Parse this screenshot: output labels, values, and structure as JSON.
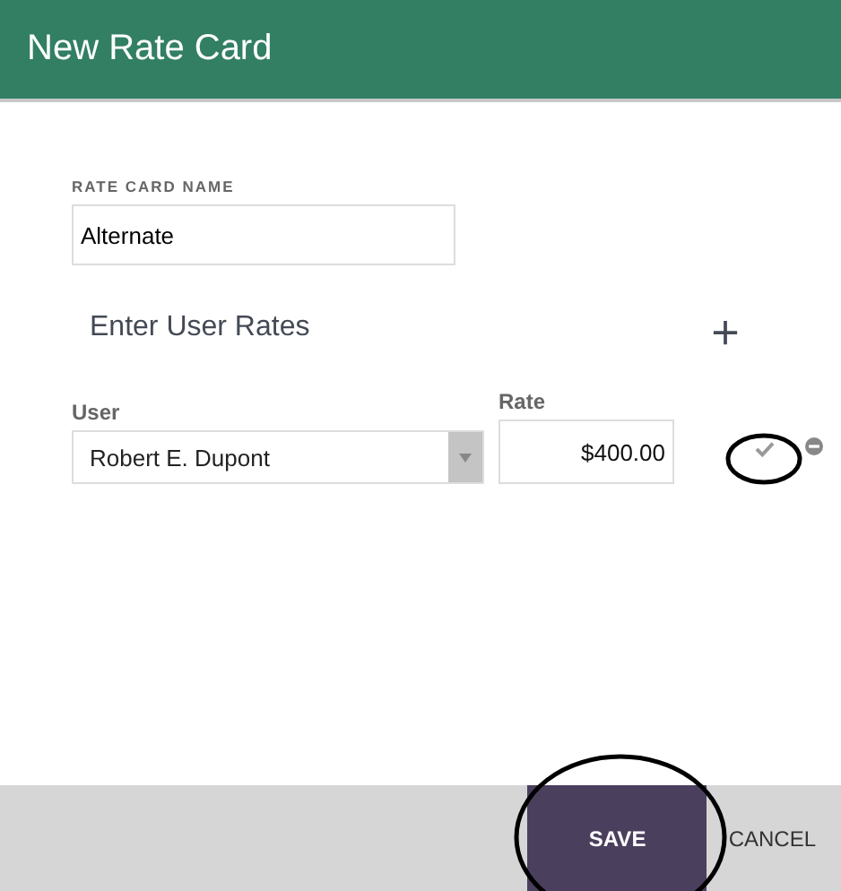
{
  "window": {
    "title": "New Rate Card"
  },
  "rate_card_name": {
    "label": "RATE CARD NAME",
    "value": "Alternate"
  },
  "user_rates": {
    "heading": "Enter User Rates",
    "rows": [
      {
        "user_label": "User",
        "user": "Robert E. Dupont",
        "rate_label": "Rate",
        "rate": "$400.00"
      }
    ]
  },
  "buttons": [
    {
      "label": "SAVE",
      "kind": "primary"
    },
    {
      "label": "CANCEL",
      "kind": "plain"
    }
  ]
}
